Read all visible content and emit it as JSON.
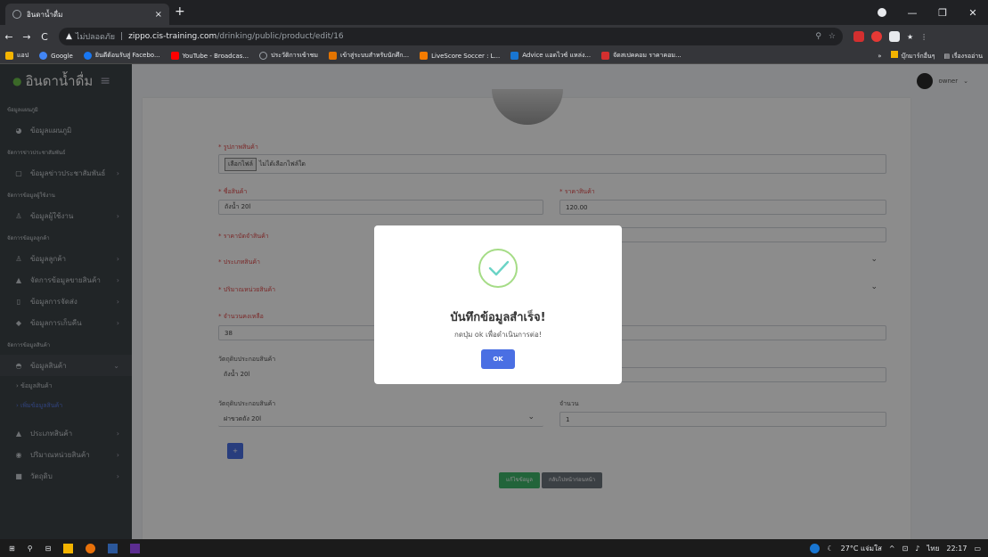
{
  "browser": {
    "tab_title": "อินดาน้ำดื่ม",
    "tab_close": "×",
    "new_tab": "+",
    "url_warning": "▲",
    "url_insecure": "ไม่ปลอดภัย",
    "url_separator": "|",
    "url_host": "zippo.cis-training.com",
    "url_path": "/drinking/public/product/edit/16",
    "window_controls": [
      "—",
      "❐",
      "✕"
    ],
    "bookmarks": [
      {
        "label": "แอป",
        "color": "#f4b400"
      },
      {
        "label": "Google",
        "color": "#4285f4"
      },
      {
        "label": "ยินดีต้อนรับสู่ Facebo...",
        "color": "#1877f2"
      },
      {
        "label": "YouTube - Broadcas...",
        "color": "#ff0000"
      },
      {
        "label": "ประวัติการเข้าชม",
        "color": "#9aa0a6"
      },
      {
        "label": "เข้าสู่ระบบสำหรับนักศึก...",
        "color": "#e37400"
      },
      {
        "label": "LiveScore Soccer : L...",
        "color": "#f57c00"
      },
      {
        "label": "Advice แอดไวซ์ แหล่ง...",
        "color": "#1976d2"
      },
      {
        "label": "จัดสเปคคอม ราคาคอม...",
        "color": "#d32f2f"
      }
    ],
    "bookmarks_more": "»",
    "other_bookmarks": "บุ๊กมาร์กอื่นๆ",
    "reading_list": "เรื่องรออ่าน"
  },
  "app": {
    "brand": "อินดาน้ำดื่ม",
    "user_name": "owner",
    "sidebar": {
      "sections": [
        {
          "title": "ข้อมูลแผนภูมิ",
          "items": [
            {
              "label": "ข้อมูลแผนภูมิ",
              "icon": "◕"
            }
          ]
        },
        {
          "title": "จัดการข่าวประชาสัมพันธ์",
          "items": [
            {
              "label": "ข้อมูลข่าวประชาสัมพันธ์",
              "icon": "▢"
            }
          ]
        },
        {
          "title": "จัดการข้อมูลผู้ใช้งาน",
          "items": [
            {
              "label": "ข้อมูลผู้ใช้งาน",
              "icon": "♙"
            }
          ]
        },
        {
          "title": "จัดการข้อมูลลูกค้า",
          "items": [
            {
              "label": "ข้อมูลลูกค้า",
              "icon": "♙"
            },
            {
              "label": "จัดการข้อมูลขายสินค้า",
              "icon": "▲"
            },
            {
              "label": "ข้อมูลการจัดส่ง",
              "icon": "▯"
            },
            {
              "label": "ข้อมูลการเก็บคืน",
              "icon": "◆"
            }
          ]
        },
        {
          "title": "จัดการข้อมูลสินค้า",
          "items": [
            {
              "label": "ข้อมูลสินค้า",
              "icon": "◓"
            }
          ]
        }
      ],
      "subitems": [
        "ข้อมูลสินค้า",
        "เพิ่มข้อมูลสินค้า"
      ],
      "bottom_items": [
        {
          "label": "ประเภทสินค้า",
          "icon": "▲"
        },
        {
          "label": "ปริมาณหน่วยสินค้า",
          "icon": "◉"
        },
        {
          "label": "วัตถุดิบ",
          "icon": "■"
        }
      ]
    },
    "form": {
      "image_label": "* รูปภาพสินค้า",
      "file_button": "เลือกไฟล์",
      "file_status": "ไม่ได้เลือกไฟล์ใด",
      "name_label": "* ชื่อสินค้า",
      "name_value": "ถังน้ำ 20l",
      "price_label": "* ราคาสินค้า",
      "price_value": "120.00",
      "price_cap_label": "* ราคาบัดจำสินค้า",
      "type_label": "* ประเภทสินค้า",
      "unit_label": "* ปริมาณหน่วยสินค้า",
      "stock_label": "* จำนวนคงเหลือ",
      "stock_value": "38",
      "material_label_1": "วัตถุดิบประกอบสินค้า",
      "material_value_1": "ถังน้ำ 20l",
      "material_label_2": "วัตถุดิบประกอบสินค้า",
      "material_value_2": "ฝาขวดถัง 20l",
      "qty_label": "จำนวน",
      "qty_value": "1",
      "plus_button": "+",
      "save_button": "แก้ไขข้อมูล",
      "back_button": "กลับไปหน้าก่อนหน้า"
    },
    "dialog": {
      "title": "บันทึกข้อมูลสำเร็จ!",
      "text": "กดปุ่ม ok เพื่อดำเนินการต่อ!",
      "ok": "OK"
    }
  },
  "taskbar": {
    "weather": "27°C แจ่มใส",
    "language": "ไทย",
    "time": "22:17"
  }
}
